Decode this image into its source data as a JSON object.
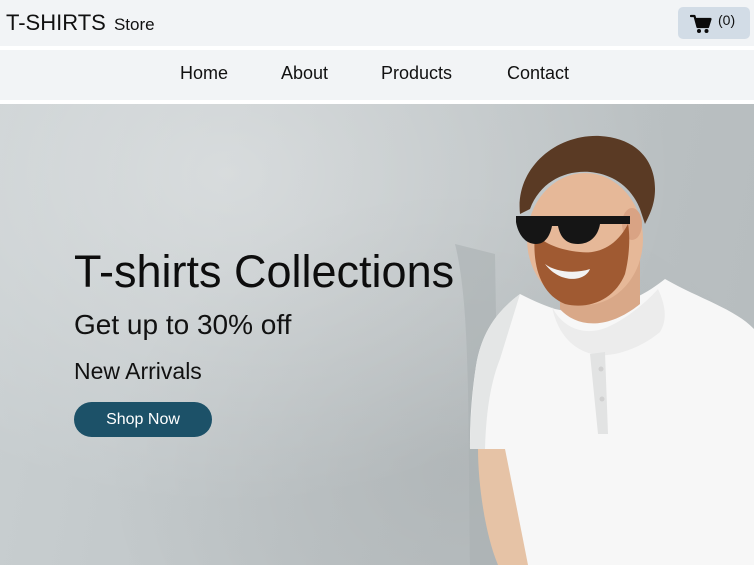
{
  "header": {
    "brand_main": "T-SHIRTS",
    "brand_sub": "Store",
    "cart_icon": "shopping-cart-icon",
    "cart_count": "(0)"
  },
  "nav": {
    "items": [
      {
        "label": "Home"
      },
      {
        "label": "About"
      },
      {
        "label": "Products"
      },
      {
        "label": "Contact"
      }
    ]
  },
  "hero": {
    "title": "T-shirts Collections",
    "subtitle": "Get up to 30% off",
    "tagline": "New Arrivals",
    "button_label": "Shop Now",
    "image": "man-in-white-polo-with-sunglasses"
  },
  "colors": {
    "bar_background": "#f2f4f6",
    "cart_button": "#d2dce6",
    "accent_button": "#1c5168",
    "hero_background": "#c2c8ca"
  }
}
